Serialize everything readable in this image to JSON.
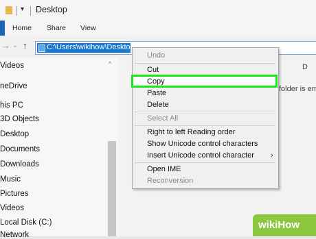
{
  "window": {
    "title": "Desktop",
    "qat": "▾"
  },
  "ribbon": {
    "tabs": [
      "Home",
      "Share",
      "View"
    ]
  },
  "address": {
    "back": "←",
    "forward": "→",
    "dropdown": "⌄",
    "up": "↑",
    "path": "C:\\Users\\wikihow\\Desktop"
  },
  "nav_pane": {
    "items": [
      "Videos",
      "neDrive",
      "his PC",
      "3D Objects",
      "Desktop",
      "Documents",
      "Downloads",
      "Music",
      "Pictures",
      "Videos",
      "Local Disk (C:)",
      "Network"
    ],
    "scroll_up": "^"
  },
  "content": {
    "column": "D",
    "empty_message": "folder is em"
  },
  "context_menu": {
    "items": [
      {
        "label": "Undo",
        "enabled": false
      },
      {
        "label": "Cut",
        "enabled": true
      },
      {
        "label": "Copy",
        "enabled": true,
        "highlighted": true
      },
      {
        "label": "Paste",
        "enabled": true
      },
      {
        "label": "Delete",
        "enabled": true
      },
      {
        "label": "Select All",
        "enabled": false
      },
      {
        "label": "Right to left Reading order",
        "enabled": true
      },
      {
        "label": "Show Unicode control characters",
        "enabled": true
      },
      {
        "label": "Insert Unicode control character",
        "enabled": true,
        "submenu": true
      },
      {
        "label": "Open IME",
        "enabled": true
      },
      {
        "label": "Reconversion",
        "enabled": false
      }
    ],
    "submenu_arrow": "›",
    "highlight_color": "#18e81a"
  },
  "watermark": {
    "text": "wikiHow"
  }
}
